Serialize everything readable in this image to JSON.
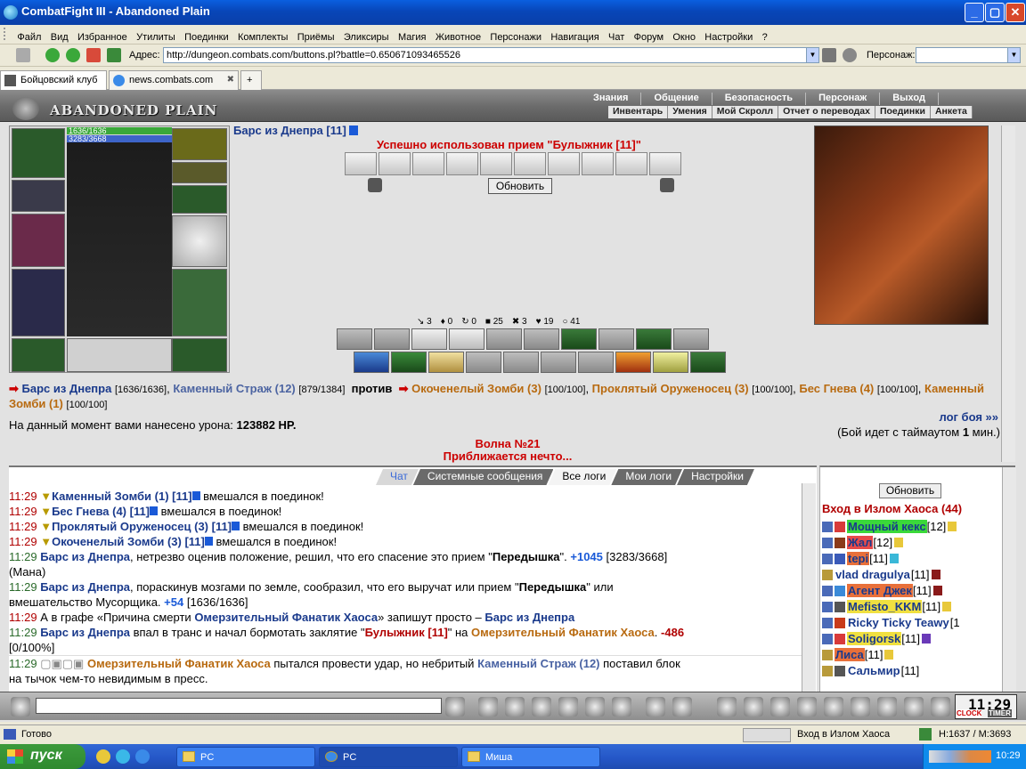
{
  "window": {
    "title": "CombatFight III - Abandoned Plain",
    "minimize": "_",
    "close": "✕"
  },
  "menu": [
    "Файл",
    "Вид",
    "Избранное",
    "Утилиты",
    "Поединки",
    "Комплекты",
    "Приёмы",
    "Эликсиры",
    "Магия",
    "Животное",
    "Персонажи",
    "Навигация",
    "Чат",
    "Форум",
    "Окно",
    "Настройки",
    "?"
  ],
  "address": {
    "label": "Адрес:",
    "url": "http://dungeon.combats.com/buttons.pl?battle=0.650671093465526",
    "person_label": "Персонаж:"
  },
  "tabs": [
    {
      "label": "Бойцовский клуб"
    },
    {
      "label": "news.combats.com"
    }
  ],
  "game": {
    "brand": "ABANDONED PLAIN",
    "top_menu": [
      "Знания",
      "Общение",
      "Безопасность",
      "Персонаж",
      "Выход"
    ],
    "sub_menu": [
      "Инвентарь",
      "Умения",
      "Мой Скролл",
      "Отчет о переводах",
      "Поединки",
      "Анкета"
    ],
    "hp": "1636/1636",
    "mp": "3283/3668",
    "opponent_title": "Барс из Днепра [11]",
    "used_msg": "Успешно использован прием \"Булыжник [11]\"",
    "refresh_label": "Обновить",
    "stats": [
      "3",
      "0",
      "0",
      "25",
      "3",
      "19",
      "41"
    ],
    "fight": {
      "self": "Барс из Днепра",
      "self_hp": "[1636/1636]",
      "ally": "Каменный Страж (12)",
      "ally_hp": "[879/1384]",
      "vs": "против",
      "enemies": [
        {
          "name": "Окоченелый Зомби (3)",
          "hp": "[100/100]"
        },
        {
          "name": "Проклятый Оруженосец (3)",
          "hp": "[100/100]"
        },
        {
          "name": "Бес Гнева (4)",
          "hp": "[100/100]"
        },
        {
          "name": "Каменный Зомби (1)",
          "hp": "[100/100]"
        }
      ]
    },
    "damage_label": "На данный момент вами нанесено урона:",
    "damage_value": "123882 HP.",
    "log_link": "лог боя »»",
    "timeout_pre": "(Бой идет с таймаутом",
    "timeout_val": "1",
    "timeout_post": "мин.)",
    "wave": "Волна №21",
    "approach": "Приближается нечто..."
  },
  "chat": {
    "tabs": [
      "Чат",
      "Системные сообщения",
      "Все логи",
      "Мои логи",
      "Настройки"
    ],
    "lines": [
      {
        "t": "11:29",
        "name": "Каменный Зомби (1) [11]",
        "text": " вмешался в поединок!"
      },
      {
        "t": "11:29",
        "name": "Бес Гнева (4) [11]",
        "text": " вмешался в поединок!"
      },
      {
        "t": "11:29",
        "name": "Проклятый Оруженосец (3) [11]",
        "text": " вмешался в поединок!"
      },
      {
        "t": "11:29",
        "name": "Окоченелый Зомби (3) [11]",
        "text": " вмешался в поединок!"
      }
    ],
    "line5": {
      "t": "11:29",
      "name": "Барс из Днепра",
      "a": ", нетрезво оценив положение, решил, что его спасение это прием \"",
      "skill": "Передышка",
      "b": "\". ",
      "num": "+1045",
      "c": " [3283/3668]",
      "d": "(Мана)"
    },
    "line6": {
      "t": "11:29",
      "name": "Барс из Днепра",
      "a": ", пораскинув мозгами по земле, сообразил, что его выручат или прием \"",
      "skill": "Передышка",
      "b": "\" или",
      "c": "вмешательство Мусорщика. ",
      "num": "+54",
      "d": " [1636/1636]"
    },
    "line7": {
      "t": "11:29",
      "a": "А в графе «Причина смерти ",
      "enemy": "Омерзительный Фанатик Хаоса",
      "b": "» запишут просто – ",
      "name": "Барс из Днепра"
    },
    "line8": {
      "t": "11:29",
      "name": "Барс из Днепра",
      "a": " впал в транс и начал бормотать заклятие \"",
      "skill": "Булыжник [11]",
      "b": "\" на ",
      "enemy": "Омерзительный Фанатик Хаоса",
      "c": ". ",
      "num": "-486",
      "d": "[0/100%]"
    },
    "line9": {
      "t": "11:29",
      "enemy": "Омерзительный Фанатик Хаоса",
      "a": " пытался провести удар, но небритый ",
      "ally": "Каменный Страж (12)",
      "b": " поставил блок",
      "c": "на тычок чем-то невидимым в пресс."
    }
  },
  "side": {
    "refresh": "Обновить",
    "title": "Вход в Излом Хаоса (44)",
    "users": [
      {
        "name": "Мощный кекс",
        "lvl": "[12]",
        "bg": "#3ad83a"
      },
      {
        "name": "Жал",
        "lvl": "[12]",
        "bg": "#e84a4a"
      },
      {
        "name": "tepi",
        "lvl": "[11]",
        "bg": "#e8703a"
      },
      {
        "name": "vlad dragulya",
        "lvl": "[11]",
        "bg": ""
      },
      {
        "name": "Агент Джек",
        "lvl": "[11]",
        "bg": "#e8703a"
      },
      {
        "name": "Mefisto_KKM",
        "lvl": "[11]",
        "bg": "#f0e040"
      },
      {
        "name": "Ricky Ticky Teawy",
        "lvl": "[1",
        "bg": ""
      },
      {
        "name": "Soligorsk",
        "lvl": "[11]",
        "bg": "#f0e040"
      },
      {
        "name": "Лиса",
        "lvl": "[11]",
        "bg": "#e8703a"
      },
      {
        "name": "Сальмир",
        "lvl": "[11]",
        "bg": ""
      }
    ]
  },
  "clock": {
    "time": "11:29",
    "tag1": "CLOCK",
    "tag2": "TIMER"
  },
  "status": {
    "ready": "Готово",
    "zone": "Вход в Излом Хаоса",
    "hm": "H:1637 / M:3693"
  },
  "taskbar": {
    "start": "пуск",
    "tasks": [
      "PC",
      "PC",
      "Миша"
    ],
    "time": "10:29"
  }
}
